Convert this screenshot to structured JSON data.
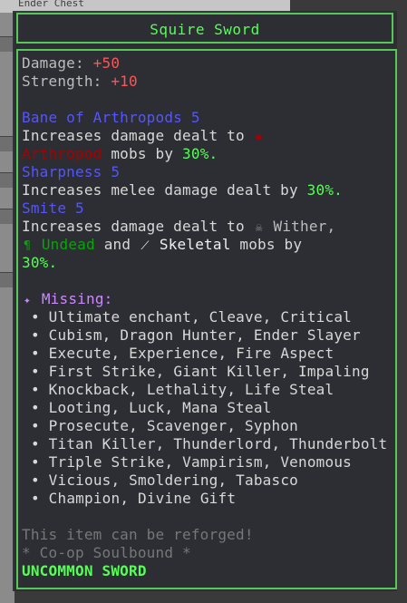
{
  "background": {
    "inventory_title": "Ender Chest"
  },
  "tooltip": {
    "title": "Squire Sword",
    "damage_label": "Damage:",
    "damage_value": "+50",
    "strength_label": "Strength:",
    "strength_value": "+10",
    "enchants": [
      {
        "name": "Bane of Arthropods 5",
        "desc_1a": "Increases damage dealt to",
        "desc_1b_icon": "spider-icon",
        "desc_2a": "Arthropod",
        "desc_2b": "mobs by",
        "desc_2c": "30%."
      },
      {
        "name": "Sharpness 5",
        "desc_a": "Increases melee damage dealt by",
        "desc_b": "30%."
      },
      {
        "name": "Smite 5",
        "desc_1a": "Increases damage dealt to",
        "desc_1b": "Wither,",
        "desc_2a": "Undead",
        "desc_2b": "and",
        "desc_2c": "Skeletal",
        "desc_2d": "mobs by",
        "desc_3": "30%."
      }
    ],
    "missing_label": "Missing:",
    "missing_items": [
      "Ultimate enchant, Cleave, Critical",
      "Cubism, Dragon Hunter, Ender Slayer",
      "Execute, Experience, Fire Aspect",
      "First Strike, Giant Killer, Impaling",
      "Knockback, Lethality, Life Steal",
      "Looting, Luck, Mana Steal",
      "Prosecute, Scavenger, Syphon",
      "Titan Killer, Thunderlord, Thunderbolt",
      "Triple Strike, Vampirism, Venomous",
      "Vicious, Smoldering, Tabasco",
      "Champion, Divine Gift"
    ],
    "reforge_text": "This item can be reforged!",
    "soulbound_text": "* Co-op Soulbound *",
    "rarity": "UNCOMMON SWORD"
  },
  "colors": {
    "frame": "#55c855",
    "title": "#55ff55",
    "stat_value": "#ff5555",
    "enchant": "#5555ff",
    "rarity": "#55ff55"
  }
}
